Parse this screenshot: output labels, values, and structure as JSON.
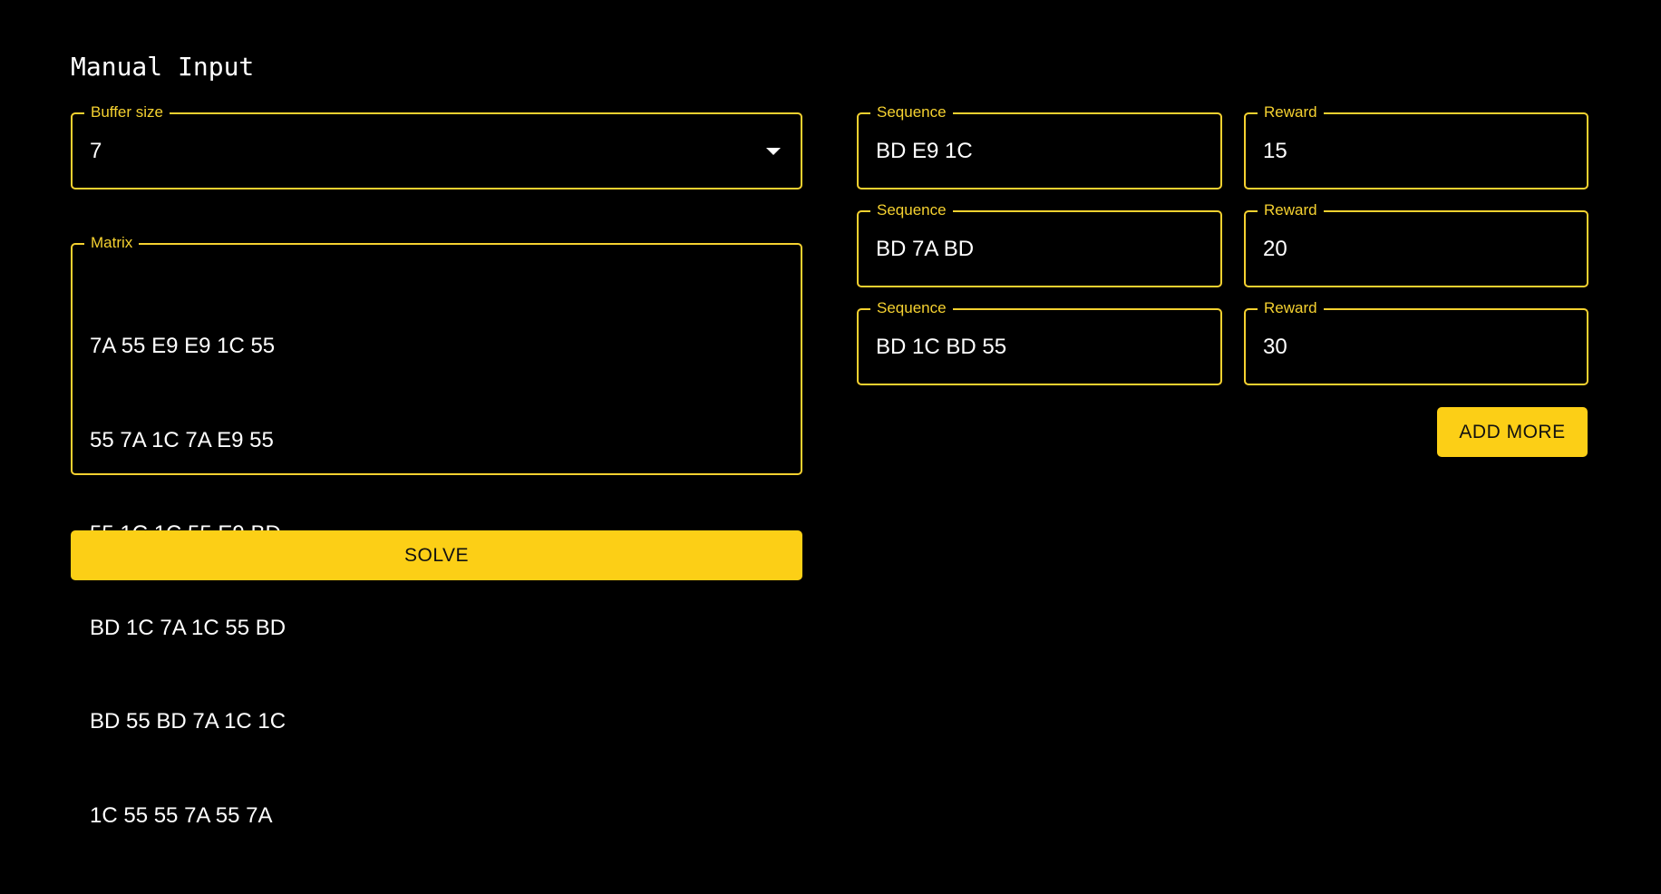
{
  "title": "Manual Input",
  "colors": {
    "accent": "#f5d130",
    "button": "#fccf16",
    "background": "#000000",
    "text": "#ffffff"
  },
  "buffer": {
    "label": "Buffer size",
    "value": "7",
    "icon": "caret-down-icon"
  },
  "matrix": {
    "label": "Matrix",
    "rows": [
      "7A 55 E9 E9 1C 55",
      "55 7A 1C 7A E9 55",
      "55 1C 1C 55 E9 BD",
      "BD 1C 7A 1C 55 BD",
      "BD 55 BD 7A 1C 1C",
      "1C 55 55 7A 55 7A"
    ]
  },
  "sequences": [
    {
      "sequence_label": "Sequence",
      "sequence": "BD E9 1C",
      "reward_label": "Reward",
      "reward": "15"
    },
    {
      "sequence_label": "Sequence",
      "sequence": "BD 7A BD",
      "reward_label": "Reward",
      "reward": "20"
    },
    {
      "sequence_label": "Sequence",
      "sequence": "BD 1C BD 55",
      "reward_label": "Reward",
      "reward": "30"
    }
  ],
  "add_more_label": "ADD MORE",
  "solve_label": "SOLVE"
}
